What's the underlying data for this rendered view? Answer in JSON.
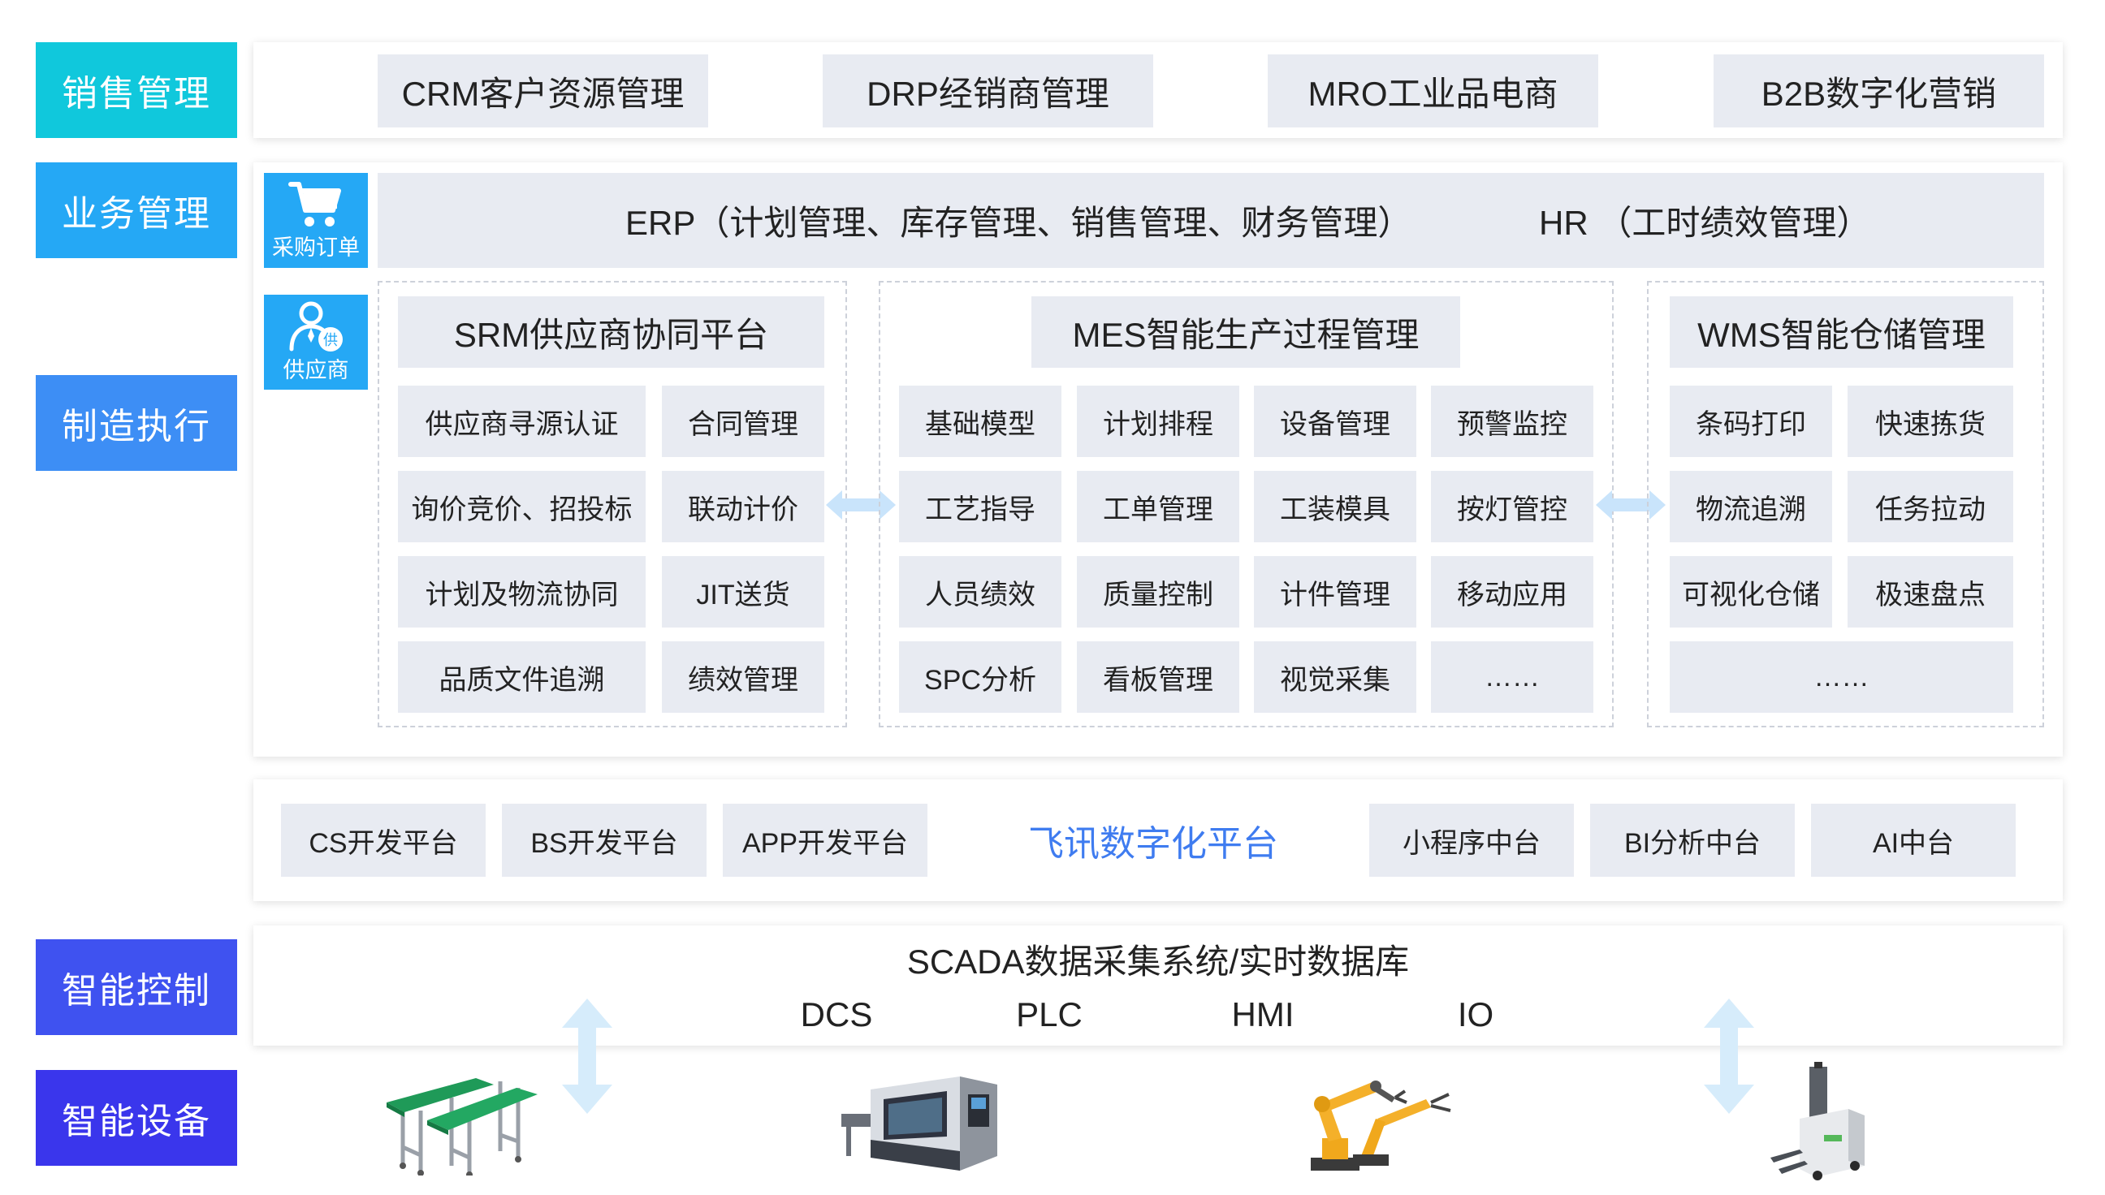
{
  "colors": {
    "sales": "#10c8dc",
    "business": "#25a8f5",
    "mfg": "#3d8ef5",
    "control": "#3f52f0",
    "device": "#3a36ec",
    "platform_text": "#3f7cf0",
    "arrow": "#c9e4fb"
  },
  "categories": {
    "sales": "销售管理",
    "business": "业务管理",
    "manufacturing": "制造执行",
    "control": "智能控制",
    "devices": "智能设备"
  },
  "sales": [
    "CRM客户资源管理",
    "DRP经销商管理",
    "MRO工业品电商",
    "B2B数字化营销"
  ],
  "business": {
    "erp": "ERP（计划管理、库存管理、销售管理、财务管理）",
    "hr": "HR （工时绩效管理）",
    "purchase_icon": "cart-icon",
    "purchase_label": "采购订单",
    "supplier_icon": "supplier-person-icon",
    "supplier_badge": "供",
    "supplier_label": "供应商"
  },
  "srm": {
    "title": "SRM供应商协同平台",
    "items": [
      "供应商寻源认证",
      "合同管理",
      "询价竞价、招投标",
      "联动计价",
      "计划及物流协同",
      "JIT送货",
      "品质文件追溯",
      "绩效管理"
    ]
  },
  "mes": {
    "title": "MES智能生产过程管理",
    "items": [
      "基础模型",
      "计划排程",
      "设备管理",
      "预警监控",
      "工艺指导",
      "工单管理",
      "工装模具",
      "按灯管控",
      "人员绩效",
      "质量控制",
      "计件管理",
      "移动应用",
      "SPC分析",
      "看板管理",
      "视觉采集",
      "……"
    ]
  },
  "wms": {
    "title": "WMS智能仓储管理",
    "items": [
      "条码打印",
      "快速拣货",
      "物流追溯",
      "任务拉动",
      "可视化仓储",
      "极速盘点",
      "……"
    ]
  },
  "platform": {
    "left": [
      "CS开发平台",
      "BS开发平台",
      "APP开发平台"
    ],
    "center": "飞讯数字化平台",
    "right": [
      "小程序中台",
      "BI分析中台",
      "AI中台"
    ]
  },
  "scada": {
    "title": "SCADA数据采集系统/实时数据库",
    "items": [
      "DCS",
      "PLC",
      "HMI",
      "IO"
    ]
  },
  "devices": [
    "conveyor-image",
    "cnc-lathe-image",
    "robot-arm-image",
    "agv-forklift-image"
  ]
}
